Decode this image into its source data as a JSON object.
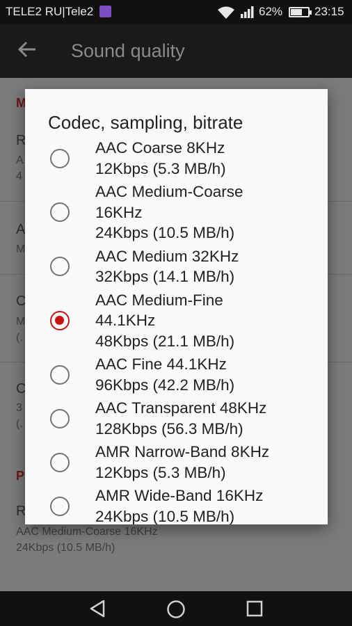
{
  "status_bar": {
    "carrier": "TELE2 RU|Tele2",
    "battery_percent": "62%",
    "battery_level": 0.62,
    "time": "23:15",
    "icons": [
      "sim-icon",
      "wifi-icon",
      "signal-icon",
      "battery-icon"
    ]
  },
  "app_bar": {
    "title": "Sound quality",
    "back_icon": "arrow-left-icon"
  },
  "background": {
    "section1_header": "M",
    "pref1_title": "R",
    "pref1_summary_line1": "A",
    "pref1_summary_line2": "4",
    "pref2_title": "A",
    "pref2_summary": "M",
    "pref3_title": "C",
    "pref3_summary_line1": "M",
    "pref3_summary_line2": "(.",
    "pref4_title": "C",
    "pref4_summary_line1": "3",
    "pref4_summary_line2": "(.",
    "section2_header": "P",
    "pref5_title": "R",
    "pref5_summary_line1": "AAC Medium-Coarse 16KHz",
    "pref5_summary_line2": "24Kbps (10.5 MB/h)"
  },
  "dialog": {
    "title": "Codec, sampling, bitrate",
    "selected_index": 3,
    "options": [
      {
        "label": "AAC Coarse 8KHz\n12Kbps (5.3 MB/h)",
        "checked": false
      },
      {
        "label": "AAC Medium-Coarse\n16KHz\n24Kbps (10.5 MB/h)",
        "checked": false
      },
      {
        "label": "AAC Medium 32KHz\n32Kbps (14.1 MB/h)",
        "checked": false
      },
      {
        "label": "AAC Medium-Fine\n44.1KHz\n48Kbps (21.1 MB/h)",
        "checked": true
      },
      {
        "label": "AAC Fine 44.1KHz\n96Kbps (42.2 MB/h)",
        "checked": false
      },
      {
        "label": "AAC Transparent 48KHz\n128Kbps (56.3 MB/h)",
        "checked": false
      },
      {
        "label": "AMR Narrow-Band 8KHz\n12Kbps (5.3 MB/h)",
        "checked": false
      },
      {
        "label": "AMR Wide-Band 16KHz\n24Kbps (10.5 MB/h)",
        "checked": false
      }
    ]
  },
  "nav_bar": {
    "icons": [
      "back-triangle-icon",
      "home-circle-icon",
      "recents-square-icon"
    ]
  },
  "colors": {
    "accent": "#c41414",
    "radio_off": "#737373",
    "dialog_bg": "#fafafa"
  }
}
